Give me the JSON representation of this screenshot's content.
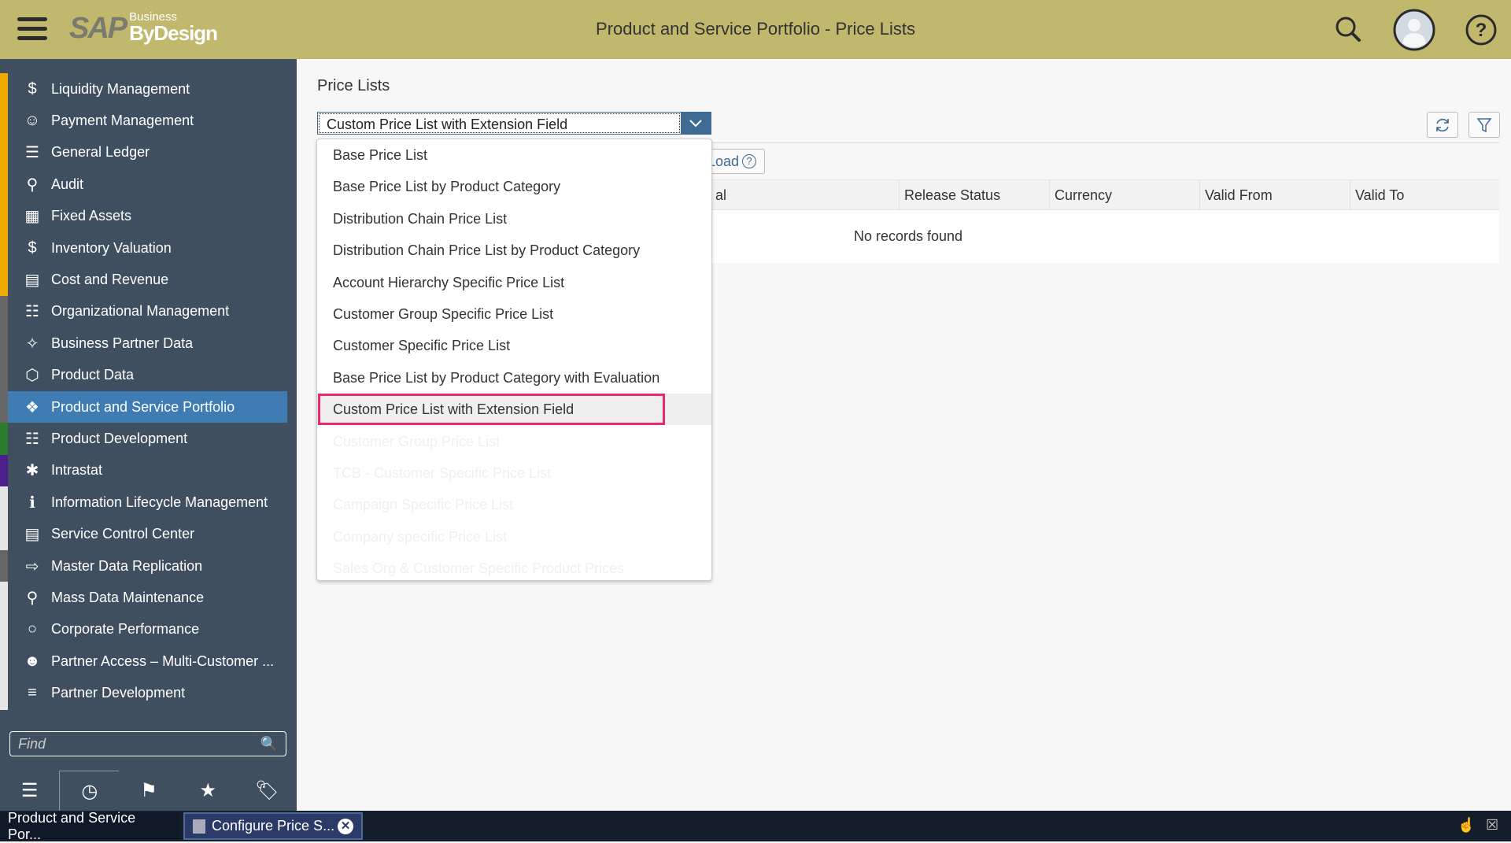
{
  "header": {
    "title": "Product and Service Portfolio - Price Lists",
    "logo_sap": "SAP",
    "logo_business": "Business",
    "logo_bydesign": "ByDesign",
    "bg_color": "#bfb86d"
  },
  "sidebar": {
    "items": [
      {
        "label": "Liquidity Management",
        "icon": "money-cycle-icon",
        "stripe": "#f0ab00"
      },
      {
        "label": "Payment Management",
        "icon": "payment-person-icon",
        "stripe": "#f0ab00"
      },
      {
        "label": "General Ledger",
        "icon": "list-icon",
        "stripe": "#f0ab00"
      },
      {
        "label": "Audit",
        "icon": "audit-search-icon",
        "stripe": "#f0ab00"
      },
      {
        "label": "Fixed Assets",
        "icon": "building-icon",
        "stripe": "#f0ab00"
      },
      {
        "label": "Inventory Valuation",
        "icon": "inventory-dollar-icon",
        "stripe": "#f0ab00"
      },
      {
        "label": "Cost and Revenue",
        "icon": "cost-document-icon",
        "stripe": "#f0ab00"
      },
      {
        "label": "Organizational Management",
        "icon": "org-chart-icon",
        "stripe": "#666666"
      },
      {
        "label": "Business Partner Data",
        "icon": "partner-chart-icon",
        "stripe": "#666666"
      },
      {
        "label": "Product Data",
        "icon": "product-box-icon",
        "stripe": "#666666"
      },
      {
        "label": "Product and Service Portfolio",
        "icon": "cubes-icon",
        "stripe": "#666666",
        "active": true
      },
      {
        "label": "Product Development",
        "icon": "hierarchy-icon",
        "stripe": "#2b7d2b"
      },
      {
        "label": "Intrastat",
        "icon": "intrastat-icon",
        "stripe": "#4b1f8a"
      },
      {
        "label": "Information Lifecycle Management",
        "icon": "info-icon",
        "stripe": "#e5e5e5"
      },
      {
        "label": "Service Control Center",
        "icon": "clipboard-icon",
        "stripe": "#e5e5e5"
      },
      {
        "label": "Master Data Replication",
        "icon": "replicate-icon",
        "stripe": "#666666"
      },
      {
        "label": "Mass Data Maintenance",
        "icon": "mass-search-icon",
        "stripe": "#e5e5e5"
      },
      {
        "label": "Corporate Performance",
        "icon": "circle-icon",
        "stripe": "#e5e5e5"
      },
      {
        "label": "Partner Access – Multi-Customer ...",
        "icon": "people-icon",
        "stripe": "#e5e5e5"
      },
      {
        "label": "Partner Development",
        "icon": "partner-dev-icon",
        "stripe": "#e5e5e5"
      }
    ],
    "find_placeholder": "Find",
    "bottom_tabs": [
      "list-icon",
      "clock-icon",
      "flag-icon",
      "favorites-icon",
      "tag-icon"
    ]
  },
  "main": {
    "label": "Price Lists",
    "selected": "Custom Price List with Extension Field",
    "load_label": "Load",
    "columns": [
      "Release Status",
      "Currency",
      "Valid From",
      "Valid To"
    ],
    "partial_column": "al",
    "empty_text": "No records found",
    "options": [
      "Base Price List",
      "Base Price List by Product Category",
      "Distribution Chain Price List",
      "Distribution Chain Price List by Product Category",
      "Account Hierarchy Specific Price List",
      "Customer Group Specific Price List",
      "Customer Specific Price List",
      "Base Price List by Product Category with Evaluation",
      "Custom Price List with Extension Field",
      "Customer Group Price List",
      "TCB - Customer Specific Price List",
      "Campaign Specific Price List",
      "Company specific Price List",
      "Sales Org & Customer Specific Product Prices"
    ],
    "highlight_color": "#ec2a68"
  },
  "taskbar": {
    "tabs": [
      "Product and Service Por...",
      "Configure Price S..."
    ]
  }
}
